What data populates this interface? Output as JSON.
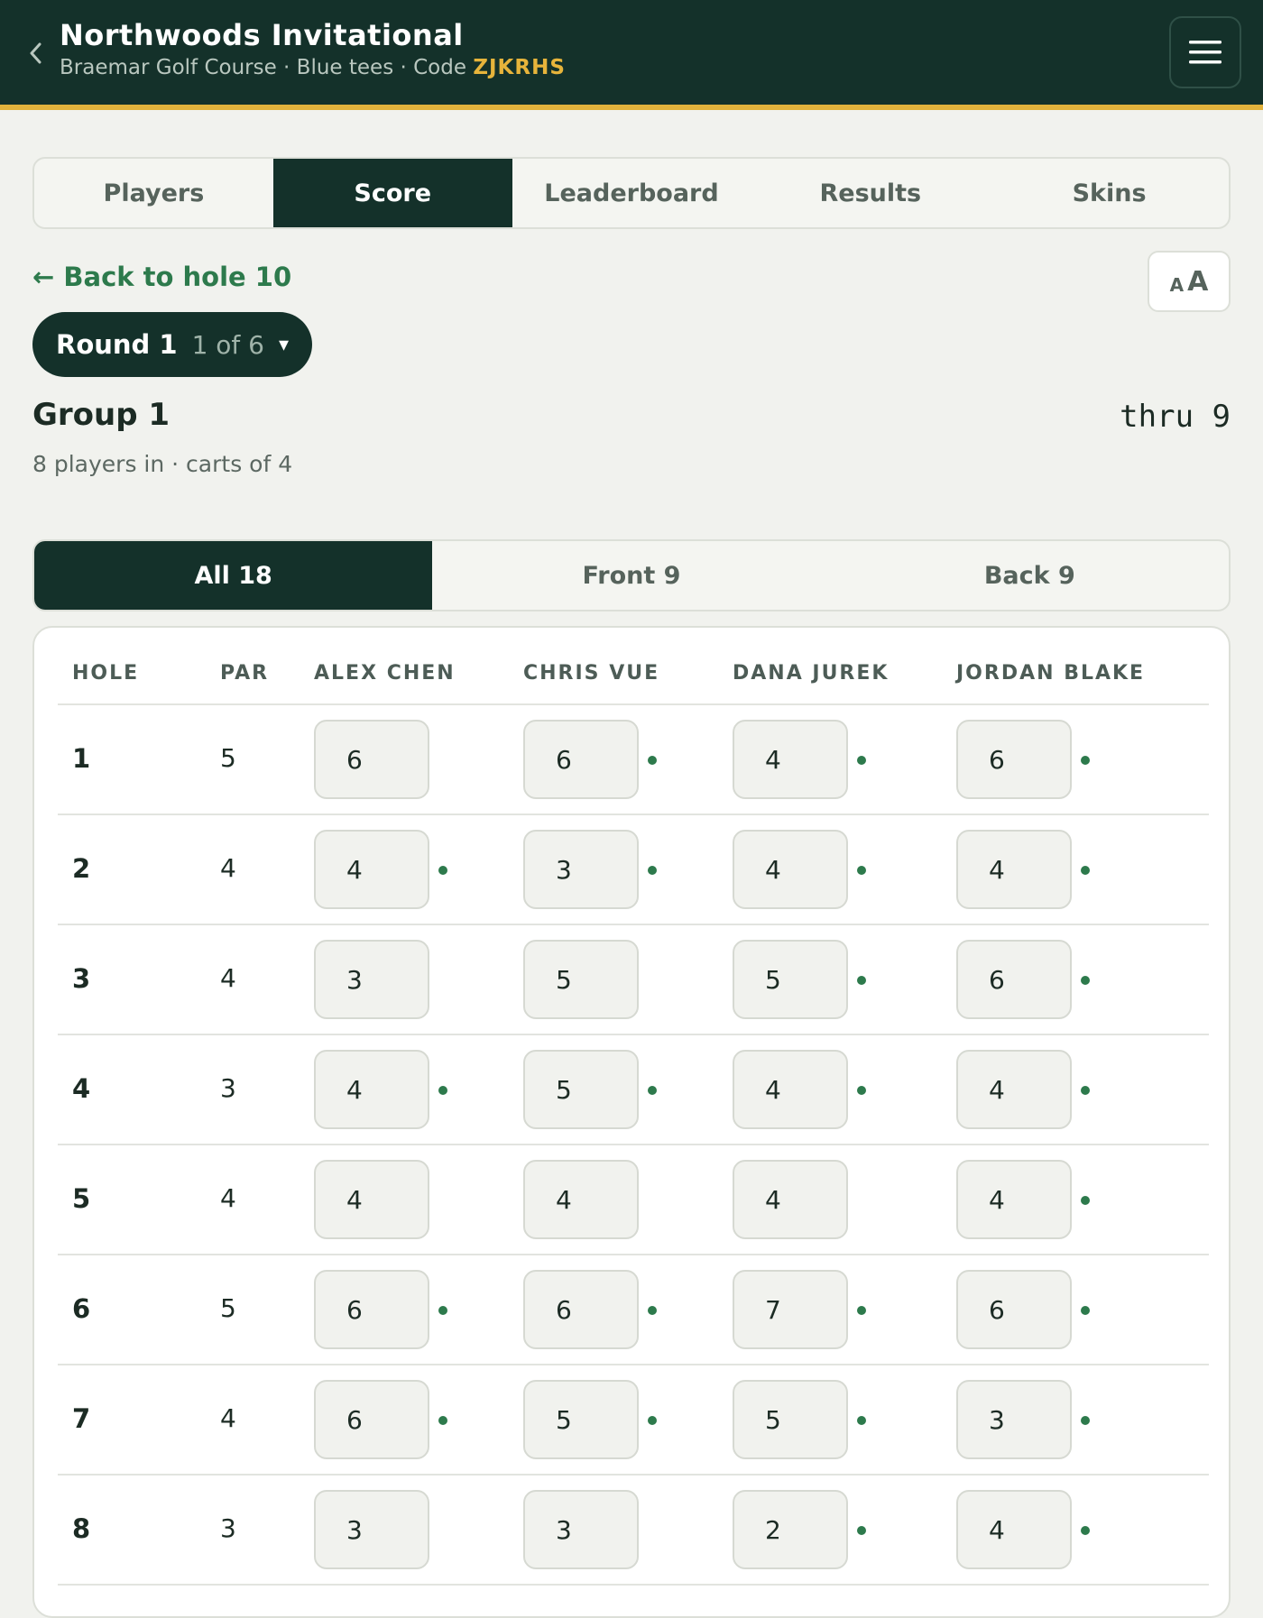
{
  "header": {
    "title": "Northwoods Invitational",
    "course": "Braemar Golf Course · Blue tees · Code",
    "code": "ZJKRHS"
  },
  "tabs": [
    "Players",
    "Score",
    "Leaderboard",
    "Results",
    "Skins"
  ],
  "active_tab": "Score",
  "back_link": "← Back to hole 10",
  "font_toggle": {
    "small": "A",
    "big": "A"
  },
  "round": {
    "label": "Round 1",
    "count": "1 of 6",
    "caret": "▾"
  },
  "group": {
    "title": "Group 1",
    "thru": "thru 9",
    "meta": "8 players in · carts of 4"
  },
  "segments": [
    "All 18",
    "Front 9",
    "Back 9"
  ],
  "active_segment": "All 18",
  "table": {
    "headers": [
      "HOLE",
      "PAR",
      "ALEX CHEN",
      "CHRIS VUE",
      "DANA JUREK",
      "JORDAN BLAKE"
    ],
    "rows": [
      {
        "hole": "1",
        "par": "5",
        "scores": [
          "6",
          "6",
          "4",
          "6"
        ],
        "dots": [
          false,
          true,
          true,
          true
        ]
      },
      {
        "hole": "2",
        "par": "4",
        "scores": [
          "4",
          "3",
          "4",
          "4"
        ],
        "dots": [
          true,
          true,
          true,
          true
        ]
      },
      {
        "hole": "3",
        "par": "4",
        "scores": [
          "3",
          "5",
          "5",
          "6"
        ],
        "dots": [
          false,
          false,
          true,
          true
        ]
      },
      {
        "hole": "4",
        "par": "3",
        "scores": [
          "4",
          "5",
          "4",
          "4"
        ],
        "dots": [
          true,
          true,
          true,
          true
        ]
      },
      {
        "hole": "5",
        "par": "4",
        "scores": [
          "4",
          "4",
          "4",
          "4"
        ],
        "dots": [
          false,
          false,
          false,
          true
        ]
      },
      {
        "hole": "6",
        "par": "5",
        "scores": [
          "6",
          "6",
          "7",
          "6"
        ],
        "dots": [
          true,
          true,
          true,
          true
        ]
      },
      {
        "hole": "7",
        "par": "4",
        "scores": [
          "6",
          "5",
          "5",
          "3"
        ],
        "dots": [
          true,
          true,
          true,
          true
        ]
      },
      {
        "hole": "8",
        "par": "3",
        "scores": [
          "3",
          "3",
          "2",
          "4"
        ],
        "dots": [
          false,
          false,
          true,
          true
        ]
      }
    ]
  },
  "colors": {
    "primary": "#14312a",
    "accent": "#e1b23c",
    "green": "#2d7a4c"
  }
}
